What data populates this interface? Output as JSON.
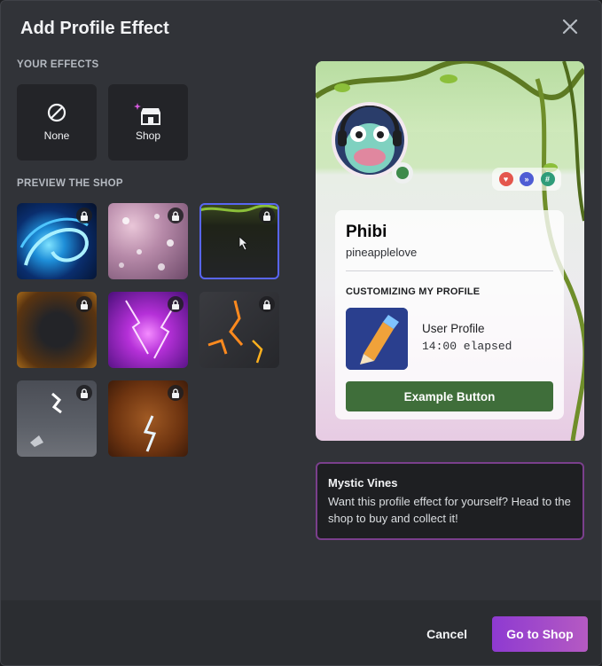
{
  "dialog": {
    "title": "Add Profile Effect"
  },
  "your_effects": {
    "heading": "YOUR EFFECTS",
    "items": [
      {
        "label": "None",
        "icon": "slash-circle-icon"
      },
      {
        "label": "Shop",
        "icon": "shop-icon"
      }
    ]
  },
  "shop_preview": {
    "heading": "PREVIEW THE SHOP",
    "items": [
      {
        "icon": "lock-icon",
        "locked": true,
        "selected": false
      },
      {
        "icon": "lock-icon",
        "locked": true,
        "selected": false
      },
      {
        "icon": "lock-icon",
        "locked": true,
        "selected": true
      },
      {
        "icon": "lock-icon",
        "locked": true,
        "selected": false
      },
      {
        "icon": "lock-icon",
        "locked": true,
        "selected": false
      },
      {
        "icon": "lock-icon",
        "locked": true,
        "selected": false
      },
      {
        "icon": "lock-icon",
        "locked": true,
        "selected": false
      },
      {
        "icon": "lock-icon",
        "locked": true,
        "selected": false
      }
    ]
  },
  "profile_preview": {
    "display_name": "Phibi",
    "username": "pineapplelove",
    "activity_heading": "CUSTOMIZING MY PROFILE",
    "activity_name": "User Profile",
    "activity_time": "14:00 elapsed",
    "button_label": "Example Button",
    "status_color": "#3e8a4b"
  },
  "effect_info": {
    "name": "Mystic Vines",
    "description": "Want this profile effect for yourself? Head to the shop to buy and collect it!"
  },
  "footer": {
    "cancel_label": "Cancel",
    "go_shop_label": "Go to Shop"
  },
  "colors": {
    "accent": "#5865f2",
    "shop_gradient_start": "#8e3ad1",
    "shop_gradient_end": "#b55ac2"
  }
}
